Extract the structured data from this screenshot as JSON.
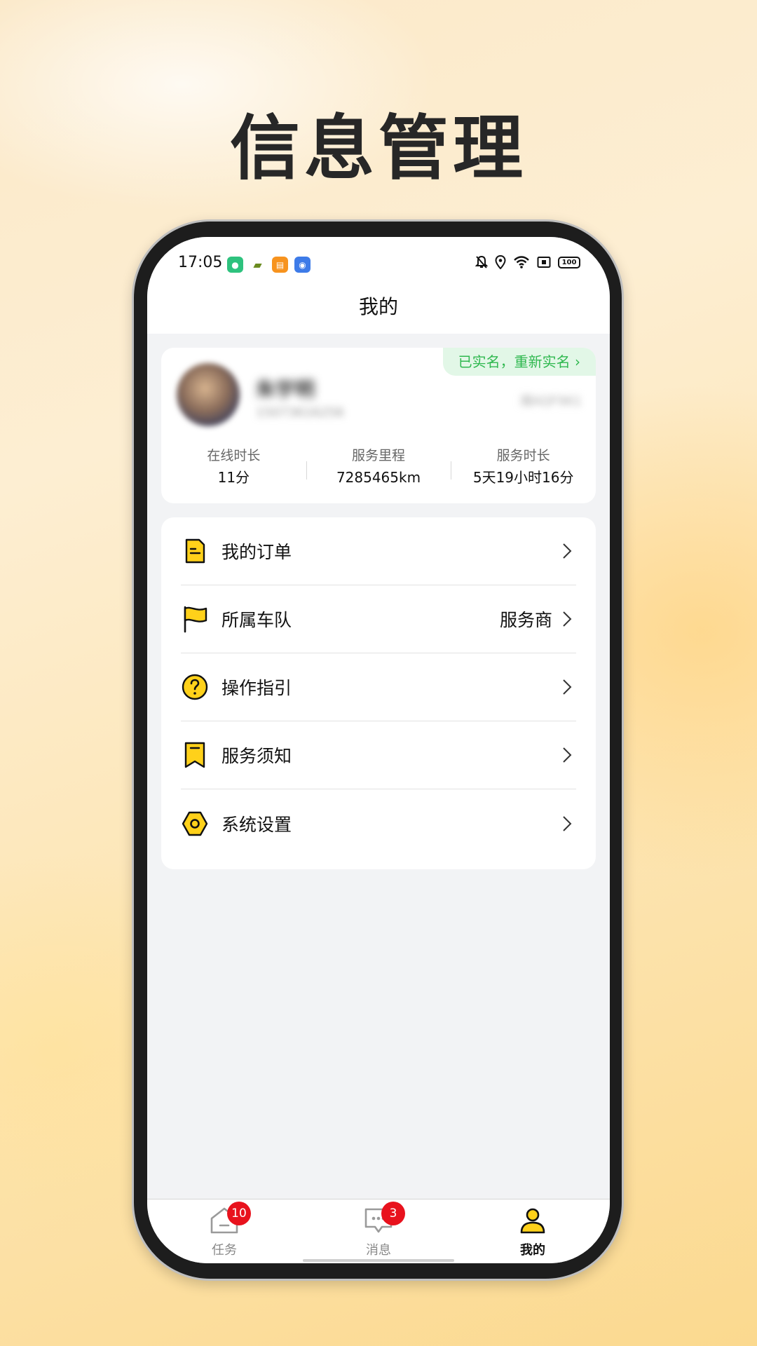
{
  "headline": "信息管理",
  "status_bar": {
    "time": "17:05",
    "battery": "100",
    "app_icons": [
      "green-app-icon",
      "truck-app-icon",
      "orange-app-icon",
      "blue-chat-app-icon"
    ],
    "system_icons": [
      "mute-bell-icon",
      "location-icon",
      "wifi-icon",
      "screen-icon",
      "battery-icon"
    ]
  },
  "nav": {
    "title": "我的"
  },
  "profile": {
    "verify_label": "已实名，重新实名 ›",
    "name_blurred": "朱宇明",
    "phone_blurred": "15073616256",
    "id_blurred": "湘AQF961",
    "stats": [
      {
        "label": "在线时长",
        "value": "11分"
      },
      {
        "label": "服务里程",
        "value": "7285465km"
      },
      {
        "label": "服务时长",
        "value": "5天19小时16分"
      }
    ]
  },
  "menu": {
    "items": [
      {
        "label": "我的订单",
        "value": "",
        "icon": "order-document-icon"
      },
      {
        "label": "所属车队",
        "value": "服务商",
        "icon": "fleet-flag-icon"
      },
      {
        "label": "操作指引",
        "value": "",
        "icon": "question-guide-icon"
      },
      {
        "label": "服务须知",
        "value": "",
        "icon": "bookmark-notice-icon"
      },
      {
        "label": "系统设置",
        "value": "",
        "icon": "settings-hexagon-icon"
      }
    ]
  },
  "tabbar": {
    "tabs": [
      {
        "label": "任务",
        "badge": "10",
        "icon": "home-task-icon"
      },
      {
        "label": "消息",
        "badge": "3",
        "icon": "message-bubble-icon"
      },
      {
        "label": "我的",
        "badge": "",
        "icon": "person-icon"
      }
    ]
  },
  "colors": {
    "accent_yellow": "#FFD11A",
    "verify_green": "#2FB84F",
    "badge_red": "#E8121D"
  }
}
